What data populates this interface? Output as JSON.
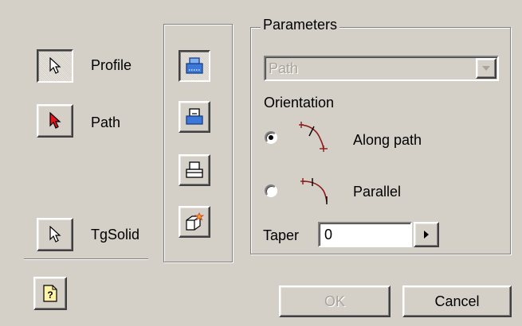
{
  "left_buttons": [
    {
      "label": "Profile",
      "pressed": true,
      "cursor_color": "#ffffff"
    },
    {
      "label": "Path",
      "pressed": false,
      "cursor_color": "#e8141c"
    },
    {
      "label": "TgSolid",
      "pressed": false,
      "cursor_color": "#ffffff"
    }
  ],
  "tool_icons": [
    "sweep-shell-icon",
    "sweep-top-icon",
    "sweep-bottom-icon",
    "sweep-box-star-icon"
  ],
  "parameters": {
    "group_title": "Parameters",
    "dropdown_value": "Path",
    "orientation_label": "Orientation",
    "options": [
      {
        "label": "Along path",
        "selected": true,
        "icon": "along-path-icon"
      },
      {
        "label": "Parallel",
        "selected": false,
        "icon": "parallel-icon"
      }
    ],
    "taper_label": "Taper",
    "taper_value": "0"
  },
  "footer": {
    "ok_label": "OK",
    "cancel_label": "Cancel",
    "help_icon": "help-icon"
  },
  "colors": {
    "background": "#d4d0c8",
    "accent_blue": "#3b78d8",
    "curve_red": "#8b1a1a"
  }
}
